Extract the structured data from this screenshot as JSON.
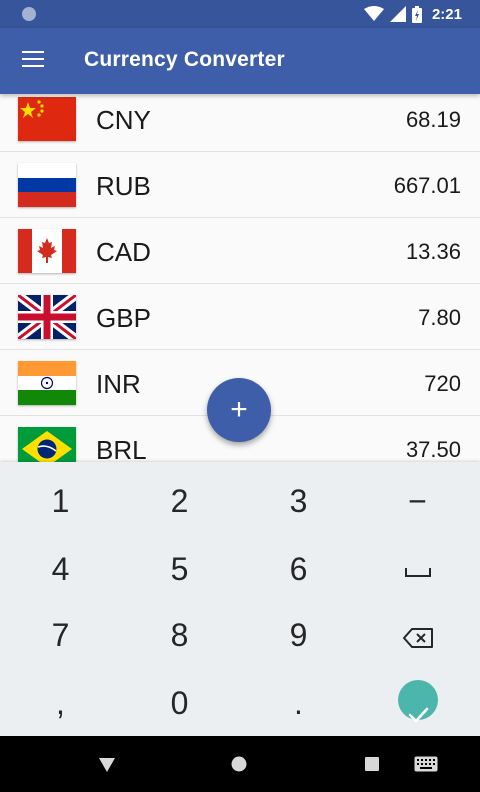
{
  "status_bar": {
    "time": "2:21"
  },
  "app_bar": {
    "title": "Currency Converter"
  },
  "currencies": [
    {
      "code": "CNY",
      "amount": "68.19",
      "flag": "china-flag"
    },
    {
      "code": "RUB",
      "amount": "667.01",
      "flag": "russia-flag"
    },
    {
      "code": "CAD",
      "amount": "13.36",
      "flag": "canada-flag"
    },
    {
      "code": "GBP",
      "amount": "7.80",
      "flag": "uk-flag"
    },
    {
      "code": "INR",
      "amount": "720",
      "flag": "india-flag"
    },
    {
      "code": "BRL",
      "amount": "37.50",
      "flag": "brazil-flag"
    }
  ],
  "fab": {
    "label": "+"
  },
  "keypad": {
    "k1": "1",
    "k2": "2",
    "k3": "3",
    "minus": "−",
    "k4": "4",
    "k5": "5",
    "k6": "6",
    "k7": "7",
    "k8": "8",
    "k9": "9",
    "comma": ",",
    "k0": "0",
    "dot": "."
  },
  "colors": {
    "primary": "#3f5eaa",
    "status_bar": "#36559a",
    "accent": "#4db6ac",
    "keypad_bg": "#eceff1"
  }
}
